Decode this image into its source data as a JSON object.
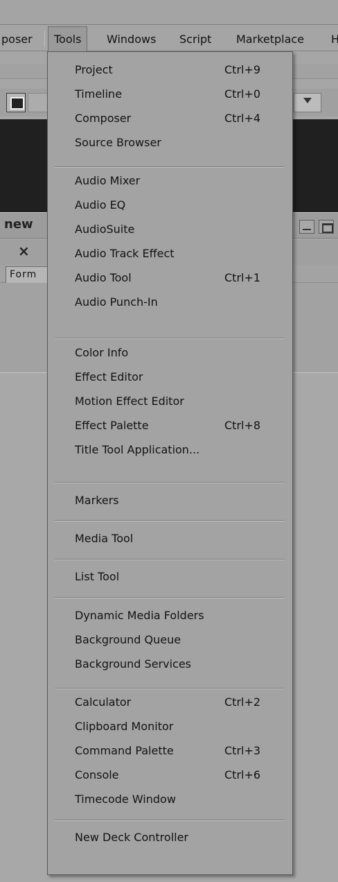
{
  "menubar": {
    "items": [
      "poser",
      "Tools",
      "Windows",
      "Script",
      "Marketplace",
      "H"
    ]
  },
  "panel": {
    "title": "new",
    "close_glyph": "×",
    "format_tab": "Form"
  },
  "tools_menu": {
    "items": [
      {
        "label": "Project",
        "shortcut": "Ctrl+9"
      },
      {
        "label": "Timeline",
        "shortcut": "Ctrl+0"
      },
      {
        "label": "Composer",
        "shortcut": "Ctrl+4"
      },
      {
        "label": "Source Browser",
        "shortcut": ""
      },
      {
        "label": "Audio Mixer",
        "shortcut": ""
      },
      {
        "label": "Audio EQ",
        "shortcut": ""
      },
      {
        "label": "AudioSuite",
        "shortcut": ""
      },
      {
        "label": "Audio Track Effect",
        "shortcut": ""
      },
      {
        "label": "Audio Tool",
        "shortcut": "Ctrl+1"
      },
      {
        "label": "Audio Punch-In",
        "shortcut": ""
      },
      {
        "label": "Color Info",
        "shortcut": ""
      },
      {
        "label": "Effect Editor",
        "shortcut": ""
      },
      {
        "label": "Motion Effect Editor",
        "shortcut": ""
      },
      {
        "label": "Effect Palette",
        "shortcut": "Ctrl+8"
      },
      {
        "label": "Title Tool Application...",
        "shortcut": ""
      },
      {
        "label": "Markers",
        "shortcut": ""
      },
      {
        "label": "Media Tool",
        "shortcut": ""
      },
      {
        "label": "List Tool",
        "shortcut": ""
      },
      {
        "label": "Dynamic Media Folders",
        "shortcut": ""
      },
      {
        "label": "Background Queue",
        "shortcut": ""
      },
      {
        "label": "Background Services",
        "shortcut": ""
      },
      {
        "label": "Calculator",
        "shortcut": "Ctrl+2"
      },
      {
        "label": "Clipboard Monitor",
        "shortcut": ""
      },
      {
        "label": "Command Palette",
        "shortcut": "Ctrl+3"
      },
      {
        "label": "Console",
        "shortcut": "Ctrl+6"
      },
      {
        "label": "Timecode Window",
        "shortcut": ""
      },
      {
        "label": "New Deck Controller",
        "shortcut": ""
      }
    ]
  }
}
